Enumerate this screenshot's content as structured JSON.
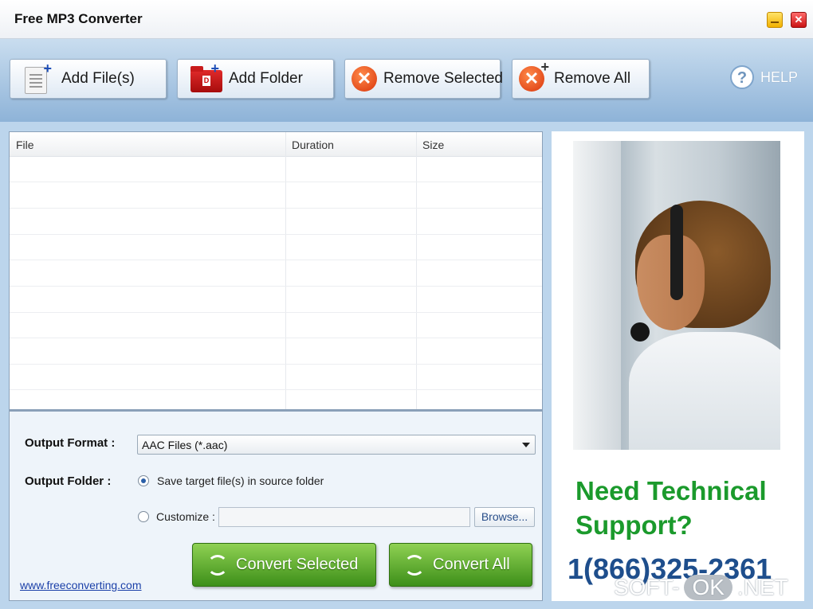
{
  "window": {
    "title": "Free MP3 Converter",
    "close_glyph": "✕"
  },
  "toolbar": {
    "add_files": "Add File(s)",
    "add_folder": "Add Folder",
    "folder_icon_glyph": "D",
    "remove_selected": "Remove Selected",
    "remove_all": "Remove All",
    "plus_glyph": "+",
    "x_glyph": "✕",
    "help": "HELP",
    "help_glyph": "?"
  },
  "file_list": {
    "columns": [
      "File",
      "Duration",
      "Size"
    ],
    "rows": []
  },
  "options": {
    "output_format_label": "Output Format :",
    "output_format_value": "AAC Files (*.aac)",
    "output_folder_label": "Output Folder :",
    "save_source_label": "Save target file(s) in source folder",
    "save_source_selected": true,
    "customize_label": "Customize :",
    "customize_selected": false,
    "customize_path": "",
    "browse_label": "Browse..."
  },
  "actions": {
    "convert_selected": "Convert Selected",
    "convert_all": "Convert All"
  },
  "footer": {
    "link": "www.freeconverting.com"
  },
  "ad": {
    "line1": "Need Technical",
    "line2": "Support?",
    "phone": "1(866)325-2361"
  },
  "watermark": {
    "left": "SOFT-",
    "mid": "OK",
    "right": ".NET"
  },
  "colors": {
    "toolbar_bg": "#8eb3d8",
    "support_green": "#1b9a2c",
    "phone_blue": "#1e4e8c",
    "convert_green": "#3d8f19"
  }
}
